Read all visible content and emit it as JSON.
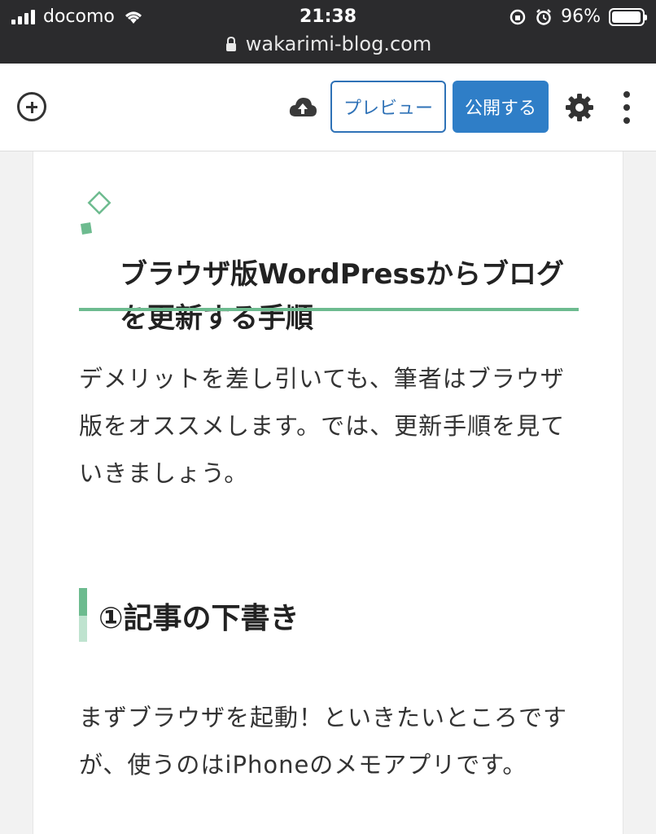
{
  "status_bar": {
    "carrier": "docomo",
    "time": "21:38",
    "battery": "96%",
    "battery_level": 0.96,
    "url": "wakarimi-blog.com"
  },
  "toolbar": {
    "preview_label": "プレビュー",
    "publish_label": "公開する",
    "accent_color": "#2f7ec7"
  },
  "content": {
    "heading": "ブラウザ版WordPressからブログを更新する手順",
    "paragraph1": "デメリットを差し引いても、筆者はブラウザ版をオススメします。では、更新手順を見ていきましょう。",
    "subheading": "①記事の下書き",
    "paragraph2": "まずブラウザを起動！といきたいところですが、使うのはiPhoneのメモアプリです。",
    "heading_accent": "#6dbb8f"
  }
}
